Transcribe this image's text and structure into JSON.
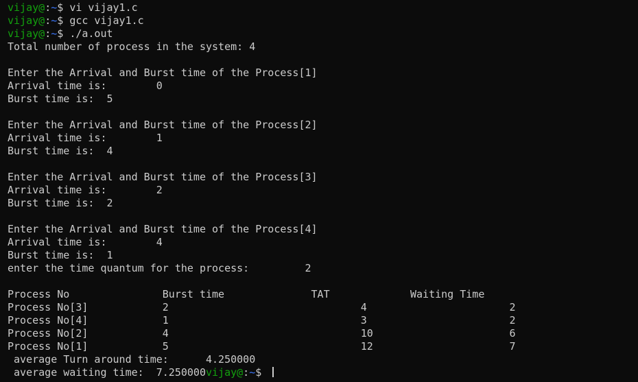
{
  "prompt": {
    "user": "vijay@",
    "colon": ":",
    "path": "~",
    "symbol": "$ "
  },
  "commands": [
    "vi vijay1.c",
    "gcc vijay1.c",
    "./a.out"
  ],
  "output": {
    "total_process_line": "Total number of process in the system: 4",
    "processes": [
      {
        "header": "Enter the Arrival and Burst time of the Process[1]",
        "arrival": "Arrival time is:        0",
        "burst": "Burst time is:  5"
      },
      {
        "header": "Enter the Arrival and Burst time of the Process[2]",
        "arrival": "Arrival time is:        1",
        "burst": "Burst time is:  4"
      },
      {
        "header": "Enter the Arrival and Burst time of the Process[3]",
        "arrival": "Arrival time is:        2",
        "burst": "Burst time is:  2"
      },
      {
        "header": "Enter the Arrival and Burst time of the Process[4]",
        "arrival": "Arrival time is:        4",
        "burst": "Burst time is:  1"
      }
    ],
    "quantum_line": "enter the time quantum for the process:         2",
    "table_header": "Process No               Burst time              TAT             Waiting Time",
    "table_rows": [
      "Process No[3]            2                               4                       2",
      "Process No[4]            1                               3                       2",
      "Process No[2]            4                               10                      6",
      "Process No[1]            5                               12                      7"
    ],
    "avg_tat_line": " average Turn around time:      4.250000",
    "avg_wait_line": " average waiting time:  7.250000"
  }
}
